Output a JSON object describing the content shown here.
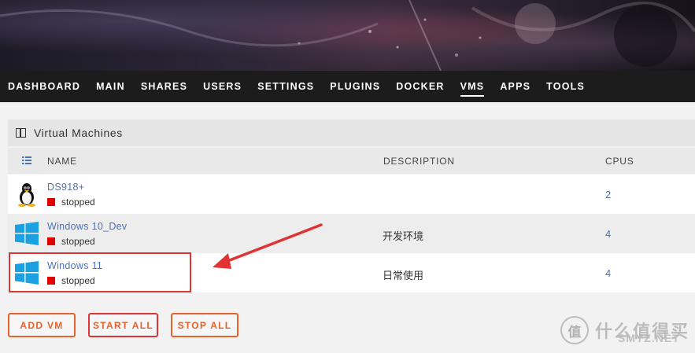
{
  "nav": {
    "items": [
      "DASHBOARD",
      "MAIN",
      "SHARES",
      "USERS",
      "SETTINGS",
      "PLUGINS",
      "DOCKER",
      "VMS",
      "APPS",
      "TOOLS"
    ],
    "active": "VMS"
  },
  "panel": {
    "title": "Virtual Machines"
  },
  "table": {
    "headers": {
      "name": "NAME",
      "description": "DESCRIPTION",
      "cpus": "CPUS"
    },
    "rows": [
      {
        "icon": "linux-penguin-icon",
        "name": "DS918+",
        "status": "stopped",
        "description": "",
        "cpus": "2"
      },
      {
        "icon": "windows-icon",
        "name": "Windows 10_Dev",
        "status": "stopped",
        "description": "开发环境",
        "cpus": "4"
      },
      {
        "icon": "windows-icon",
        "name": "Windows 11",
        "status": "stopped",
        "description": "日常使用",
        "cpus": "4"
      }
    ]
  },
  "buttons": {
    "add_vm": "ADD VM",
    "start_all": "START ALL",
    "stop_all": "STOP ALL"
  },
  "watermark": {
    "logo": "值",
    "text": "什么值得买",
    "sub": "SMYZ.NET"
  },
  "colors": {
    "accent_orange": "#e8602a",
    "highlight_red": "#e03434",
    "link_blue": "#4a72b8",
    "status_stopped": "#e00000",
    "nav_bg": "#1c1c1c"
  }
}
